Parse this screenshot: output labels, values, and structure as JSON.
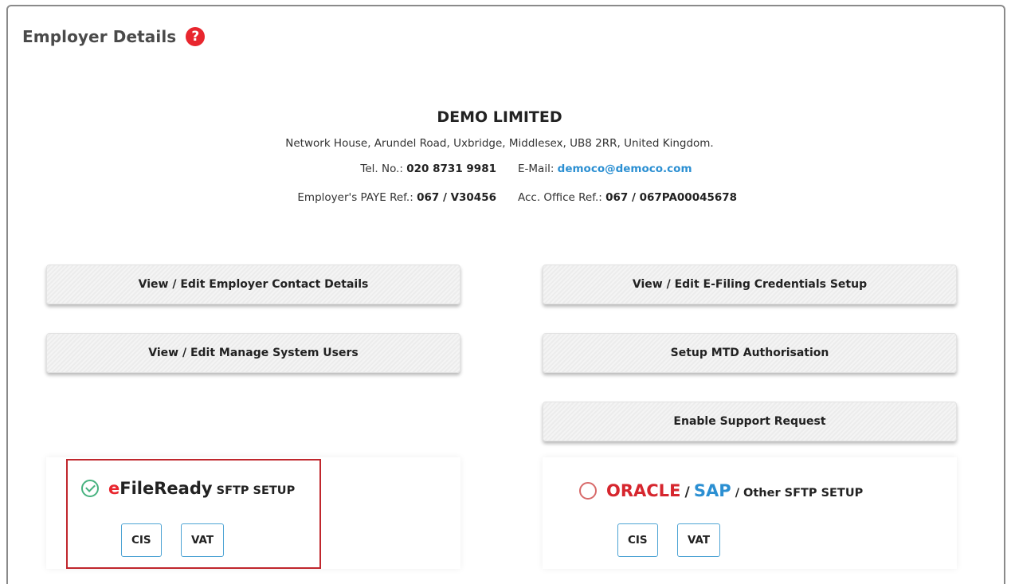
{
  "header": {
    "title": "Employer Details",
    "help_glyph": "?"
  },
  "company": {
    "name": "DEMO LIMITED",
    "address": "Network House, Arundel Road, Uxbridge, Middlesex, UB8 2RR, United Kingdom.",
    "tel_label": "Tel. No.:",
    "tel_value": "020 8731 9981",
    "email_label": "E-Mail:",
    "email_value": "democo@democo.com",
    "paye_label": "Employer's PAYE Ref.:",
    "paye_value": "067 / V30456",
    "acc_label": "Acc. Office Ref.:",
    "acc_value": "067 / 067PA00045678"
  },
  "buttons": {
    "contact_details": "View / Edit Employer Contact Details",
    "efiling_credentials": "View / Edit E-Filing Credentials Setup",
    "system_users": "View / Edit Manage System Users",
    "mtd_authorisation": "Setup MTD Authorisation",
    "support_request": "Enable Support Request"
  },
  "sftp": {
    "efileready": {
      "brand_e": "e",
      "brand_rest": "FileReady",
      "suffix": "SFTP SETUP",
      "selected": true,
      "cis_label": "CIS",
      "vat_label": "VAT"
    },
    "other": {
      "oracle": "ORACLE",
      "sep1": "/",
      "sap": "SAP",
      "rest": "/ Other SFTP SETUP",
      "selected": false,
      "cis_label": "CIS",
      "vat_label": "VAT"
    }
  },
  "colors": {
    "accent_red": "#e8262e",
    "link_blue": "#2b8fd2",
    "check_green": "#47b27f",
    "selection_border": "#c0272d"
  }
}
